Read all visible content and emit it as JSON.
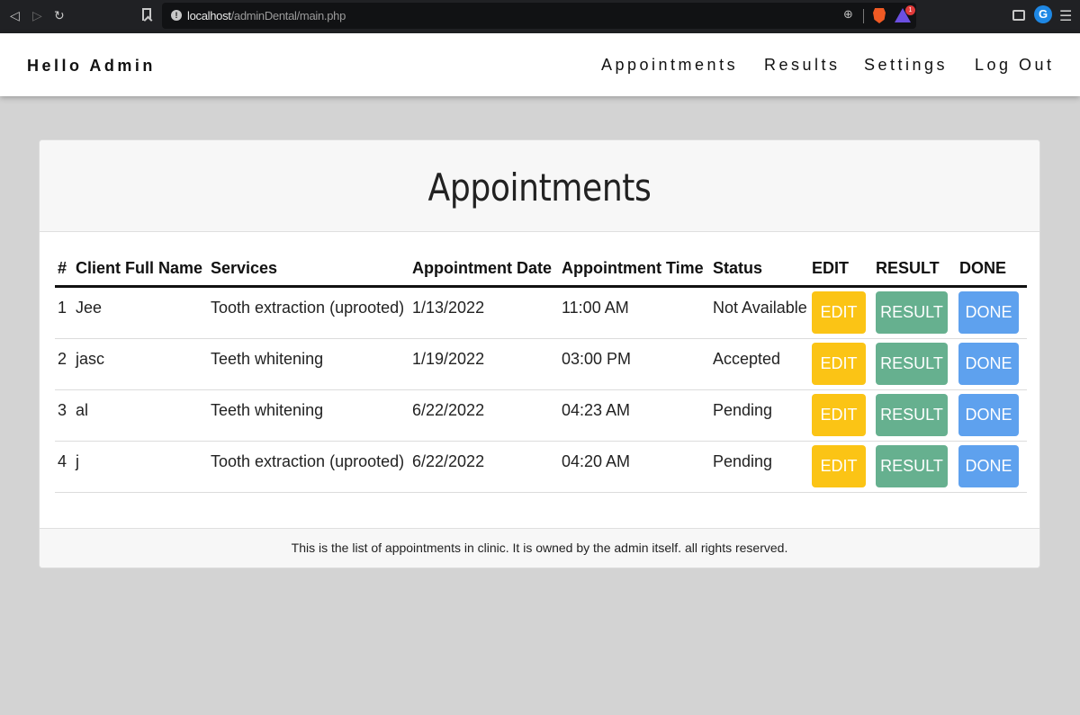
{
  "browser": {
    "url_host": "localhost",
    "url_path": "/adminDental/main.php",
    "rewards_count": "1",
    "extension_letter": "G"
  },
  "navbar": {
    "brand": "Hello Admin",
    "links": [
      "Appointments",
      "Results",
      "Settings",
      "Log Out"
    ]
  },
  "card": {
    "title": "Appointments",
    "footer": "This is the list of appointments in clinic. It is owned by the admin itself. all rights reserved."
  },
  "table": {
    "headers": [
      "#",
      "Client Full Name",
      "Services",
      "Appointment Date",
      "Appointment Time",
      "Status",
      "EDIT",
      "RESULT",
      "DONE"
    ],
    "rows": [
      {
        "num": "1",
        "name": "Jee",
        "service": "Tooth extraction (uprooted)",
        "date": "1/13/2022",
        "time": "11:00 AM",
        "status": "Not Available"
      },
      {
        "num": "2",
        "name": "jasc",
        "service": "Teeth whitening",
        "date": "1/19/2022",
        "time": "03:00 PM",
        "status": "Accepted"
      },
      {
        "num": "3",
        "name": "al",
        "service": "Teeth whitening",
        "date": "6/22/2022",
        "time": "04:23 AM",
        "status": "Pending"
      },
      {
        "num": "4",
        "name": "j",
        "service": "Tooth extraction (uprooted)",
        "date": "6/22/2022",
        "time": "04:20 AM",
        "status": "Pending"
      }
    ],
    "button_labels": {
      "edit": "EDIT",
      "result": "RESULT",
      "done": "DONE"
    }
  },
  "colors": {
    "edit": "#fbc415",
    "result": "#66b08f",
    "done": "#5ea1ee",
    "page_background": "#d3d3d3"
  }
}
